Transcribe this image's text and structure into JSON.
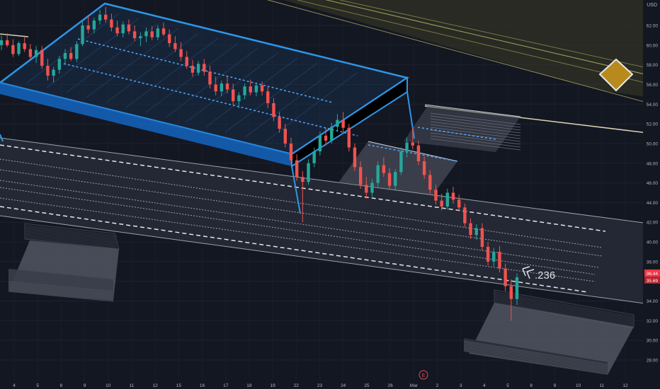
{
  "chart_data": {
    "type": "candlestick",
    "currency_label": "USD",
    "y_ticks": [
      "62.00",
      "60.00",
      "58.00",
      "56.00",
      "54.00",
      "52.00",
      "50.00",
      "48.00",
      "46.00",
      "44.00",
      "42.00",
      "40.00",
      "38.00",
      "36.00",
      "34.00",
      "32.00",
      "30.00",
      "28.00"
    ],
    "x_ticks": [
      "4",
      "5",
      "8",
      "9",
      "10",
      "11",
      "12",
      "15",
      "16",
      "17",
      "18",
      "19",
      "22",
      "23",
      "24",
      "25",
      "26",
      "Mar",
      "2",
      "3",
      "4",
      "5",
      "8",
      "9",
      "10",
      "11",
      "12"
    ],
    "ylim": [
      26.5,
      64.5
    ],
    "last_price_label": "36.44",
    "prev_price_label": "35.69",
    "fib_label": ".236",
    "event_marker": "E",
    "candles": [
      [
        60.0,
        61.0,
        59.5,
        60.5
      ],
      [
        60.5,
        61.2,
        59.8,
        60.0
      ],
      [
        60.0,
        60.6,
        58.8,
        59.1
      ],
      [
        59.1,
        60.4,
        58.9,
        60.2
      ],
      [
        60.2,
        60.8,
        59.3,
        59.6
      ],
      [
        59.6,
        60.1,
        58.5,
        58.8
      ],
      [
        58.8,
        59.9,
        58.2,
        59.5
      ],
      [
        59.5,
        59.9,
        57.6,
        57.9
      ],
      [
        57.9,
        58.6,
        56.4,
        56.9
      ],
      [
        56.9,
        57.8,
        56.2,
        57.5
      ],
      [
        57.5,
        58.9,
        57.1,
        58.6
      ],
      [
        58.6,
        59.6,
        58.0,
        59.2
      ],
      [
        59.2,
        59.8,
        58.4,
        58.6
      ],
      [
        58.6,
        60.4,
        58.3,
        60.1
      ],
      [
        60.1,
        62.4,
        59.9,
        62.0
      ],
      [
        62.0,
        63.0,
        61.2,
        61.6
      ],
      [
        61.6,
        62.8,
        61.2,
        62.5
      ],
      [
        62.5,
        63.6,
        62.1,
        63.1
      ],
      [
        63.1,
        63.9,
        62.3,
        62.6
      ],
      [
        62.6,
        63.2,
        61.4,
        61.8
      ],
      [
        61.8,
        62.5,
        60.9,
        61.2
      ],
      [
        61.2,
        62.4,
        60.8,
        62.1
      ],
      [
        62.1,
        62.6,
        61.1,
        61.4
      ],
      [
        61.4,
        62.0,
        60.4,
        60.7
      ],
      [
        60.7,
        61.3,
        59.9,
        60.9
      ],
      [
        60.9,
        61.8,
        60.3,
        61.4
      ],
      [
        61.4,
        61.9,
        60.5,
        60.8
      ],
      [
        60.8,
        62.0,
        60.5,
        61.7
      ],
      [
        61.7,
        62.3,
        60.9,
        61.1
      ],
      [
        61.1,
        61.6,
        59.8,
        60.2
      ],
      [
        60.2,
        60.9,
        59.3,
        59.6
      ],
      [
        59.6,
        60.3,
        58.4,
        58.8
      ],
      [
        58.8,
        59.4,
        57.6,
        57.9
      ],
      [
        57.9,
        58.5,
        56.8,
        57.2
      ],
      [
        57.2,
        58.4,
        56.9,
        58.1
      ],
      [
        58.1,
        58.6,
        56.9,
        57.3
      ],
      [
        57.3,
        57.9,
        55.6,
        56.0
      ],
      [
        56.0,
        56.8,
        54.9,
        55.3
      ],
      [
        55.3,
        56.4,
        54.8,
        56.1
      ],
      [
        56.1,
        56.9,
        55.1,
        55.5
      ],
      [
        55.5,
        56.1,
        53.9,
        54.3
      ],
      [
        54.3,
        55.2,
        53.6,
        54.9
      ],
      [
        54.9,
        56.1,
        54.5,
        55.8
      ],
      [
        55.8,
        56.5,
        54.9,
        55.2
      ],
      [
        55.2,
        56.2,
        54.8,
        55.9
      ],
      [
        55.9,
        56.3,
        54.9,
        55.3
      ],
      [
        55.3,
        55.8,
        53.6,
        54.1
      ],
      [
        54.1,
        54.6,
        52.3,
        52.7
      ],
      [
        52.7,
        53.2,
        51.1,
        51.5
      ],
      [
        51.5,
        52.0,
        49.6,
        50.0
      ],
      [
        50.0,
        50.6,
        47.9,
        48.3
      ],
      [
        48.3,
        48.9,
        46.2,
        46.6
      ],
      [
        46.6,
        47.2,
        42.0,
        46.1
      ],
      [
        46.1,
        48.4,
        45.8,
        48.0
      ],
      [
        48.0,
        49.6,
        47.6,
        49.2
      ],
      [
        49.2,
        51.2,
        48.8,
        50.8
      ],
      [
        50.8,
        51.6,
        49.8,
        50.3
      ],
      [
        50.3,
        52.1,
        50.0,
        51.7
      ],
      [
        51.7,
        53.0,
        51.2,
        52.4
      ],
      [
        52.4,
        53.2,
        51.1,
        51.6
      ],
      [
        51.6,
        52.0,
        49.2,
        49.6
      ],
      [
        49.6,
        50.0,
        47.2,
        47.6
      ],
      [
        47.6,
        48.2,
        45.4,
        45.8
      ],
      [
        45.8,
        46.6,
        44.4,
        45.0
      ],
      [
        45.0,
        46.4,
        44.6,
        46.0
      ],
      [
        46.0,
        48.2,
        45.6,
        47.8
      ],
      [
        47.8,
        48.6,
        46.6,
        47.0
      ],
      [
        47.0,
        47.5,
        45.3,
        45.7
      ],
      [
        45.7,
        47.4,
        45.2,
        47.1
      ],
      [
        47.1,
        49.6,
        46.8,
        49.2
      ],
      [
        49.2,
        50.6,
        48.6,
        50.1
      ],
      [
        50.1,
        51.6,
        49.4,
        49.8
      ],
      [
        49.8,
        50.3,
        47.8,
        48.2
      ],
      [
        48.2,
        48.7,
        46.4,
        46.8
      ],
      [
        46.8,
        47.3,
        44.9,
        45.3
      ],
      [
        45.3,
        45.8,
        43.8,
        44.2
      ],
      [
        44.2,
        44.9,
        43.2,
        43.6
      ],
      [
        43.6,
        45.4,
        43.3,
        45.0
      ],
      [
        45.0,
        45.6,
        43.9,
        44.3
      ],
      [
        44.3,
        44.8,
        43.1,
        43.5
      ],
      [
        43.5,
        43.9,
        41.5,
        41.9
      ],
      [
        41.9,
        42.4,
        40.3,
        40.7
      ],
      [
        40.7,
        41.8,
        40.2,
        41.4
      ],
      [
        41.4,
        41.9,
        39.1,
        39.5
      ],
      [
        39.5,
        40.0,
        37.6,
        38.0
      ],
      [
        38.0,
        39.4,
        37.5,
        39.0
      ],
      [
        39.0,
        39.6,
        36.9,
        37.3
      ],
      [
        37.3,
        37.8,
        35.0,
        35.5
      ],
      [
        35.5,
        36.2,
        32.0,
        34.2
      ],
      [
        34.2,
        36.8,
        33.6,
        36.4
      ]
    ]
  }
}
